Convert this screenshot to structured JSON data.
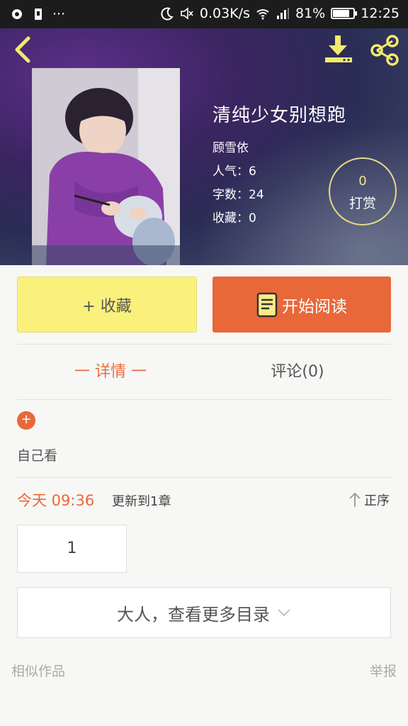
{
  "status_bar": {
    "network_speed": "0.03K/s",
    "battery_percent": "81%",
    "battery_level": 0.81,
    "time": "12:25",
    "dots": "···"
  },
  "book": {
    "title": "清纯少女别想跑",
    "author": "顾雪依",
    "popularity": "人气：6",
    "word_count": "字数：24",
    "favorites": "收藏：0",
    "reward_count": "0",
    "reward_label": "打赏"
  },
  "actions": {
    "collect_label": "+ 收藏",
    "read_label": "开始阅读"
  },
  "tabs": {
    "detail": "一 详情 一",
    "comments": "评论(0)"
  },
  "detail": {
    "plus": "+",
    "description": "自己看",
    "update_time": "今天 09:36",
    "update_text": "更新到1章",
    "sort_label": "正序",
    "chapter": "1",
    "more_catalog": "大人，查看更多目录"
  },
  "footer": {
    "similar": "相似作品",
    "report": "举报"
  },
  "colors": {
    "accent": "#e8683a",
    "collect_bg": "#faf17d",
    "icon_yellow": "#f5ea6e"
  }
}
